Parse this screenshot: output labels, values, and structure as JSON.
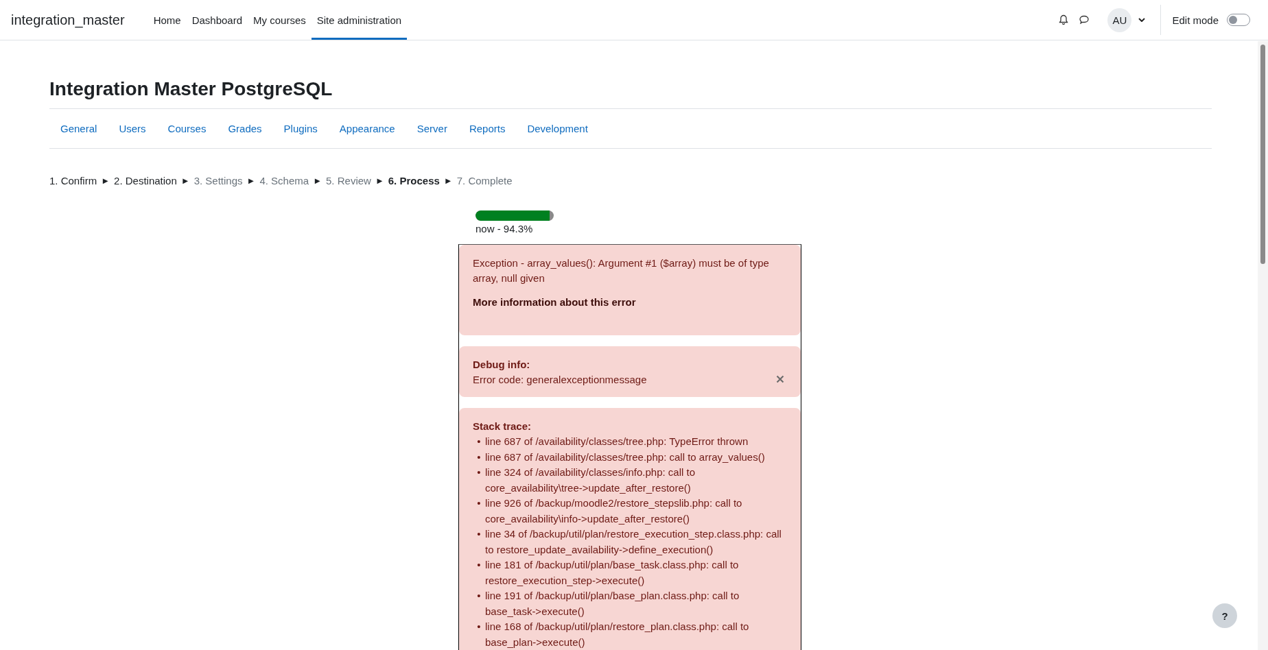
{
  "navbar": {
    "site_name": "integration_master",
    "links": [
      {
        "label": "Home",
        "selected": false
      },
      {
        "label": "Dashboard",
        "selected": false
      },
      {
        "label": "My courses",
        "selected": false
      },
      {
        "label": "Site administration",
        "selected": true
      }
    ],
    "avatar": "AU",
    "edit_mode": {
      "label": "Edit mode",
      "on": false
    }
  },
  "page_title": "Integration Master PostgreSQL",
  "tabs": [
    {
      "label": "General"
    },
    {
      "label": "Users"
    },
    {
      "label": "Courses"
    },
    {
      "label": "Grades"
    },
    {
      "label": "Plugins"
    },
    {
      "label": "Appearance"
    },
    {
      "label": "Server"
    },
    {
      "label": "Reports"
    },
    {
      "label": "Development"
    }
  ],
  "steps": [
    {
      "label": "1. Confirm",
      "kind": "done",
      "arrow": "►"
    },
    {
      "label": "2. Destination",
      "kind": "done",
      "arrow": "►"
    },
    {
      "label": "3. Settings",
      "kind": "pending",
      "arrow": "►"
    },
    {
      "label": "4. Schema",
      "kind": "pending",
      "arrow": "►"
    },
    {
      "label": "5. Review",
      "kind": "pending",
      "arrow": "►"
    },
    {
      "label": "6. Process",
      "kind": "current",
      "arrow": "►"
    },
    {
      "label": "7. Complete",
      "kind": "pending"
    }
  ],
  "progress": {
    "level": 0.943,
    "label": "now - 94.3%"
  },
  "alerts": [
    {
      "kind": "message",
      "text": "Exception - array_values(): Argument #1 ($array) must be of type array, null given",
      "link": "More information about this error"
    },
    {
      "kind": "debug",
      "heading": "Debug info:",
      "text": "Error code: generalexceptionmessage"
    },
    {
      "kind": "trace",
      "heading": "Stack trace:",
      "items": [
        {
          "bullet": "•",
          "text": "line 687 of /availability/classes/tree.php: TypeError thrown"
        },
        {
          "bullet": "•",
          "text": "line 687 of /availability/classes/tree.php: call to array_values()"
        },
        {
          "bullet": "•",
          "text": "line 324 of /availability/classes/info.php: call to core_availability\\tree->update_after_restore()"
        },
        {
          "bullet": "•",
          "text": "line 926 of /backup/moodle2/restore_stepslib.php: call to core_availability\\info->update_after_restore()"
        },
        {
          "bullet": "•",
          "text": "line 34 of /backup/util/plan/restore_execution_step.class.php: call to restore_update_availability->define_execution()"
        },
        {
          "bullet": "•",
          "text": "line 181 of /backup/util/plan/base_task.class.php: call to restore_execution_step->execute()"
        },
        {
          "bullet": "•",
          "text": "line 191 of /backup/util/plan/base_plan.class.php: call to base_task->execute()"
        },
        {
          "bullet": "•",
          "text": "line 168 of /backup/util/plan/restore_plan.class.php: call to base_plan->execute()"
        }
      ]
    }
  ],
  "help_button": "?"
}
